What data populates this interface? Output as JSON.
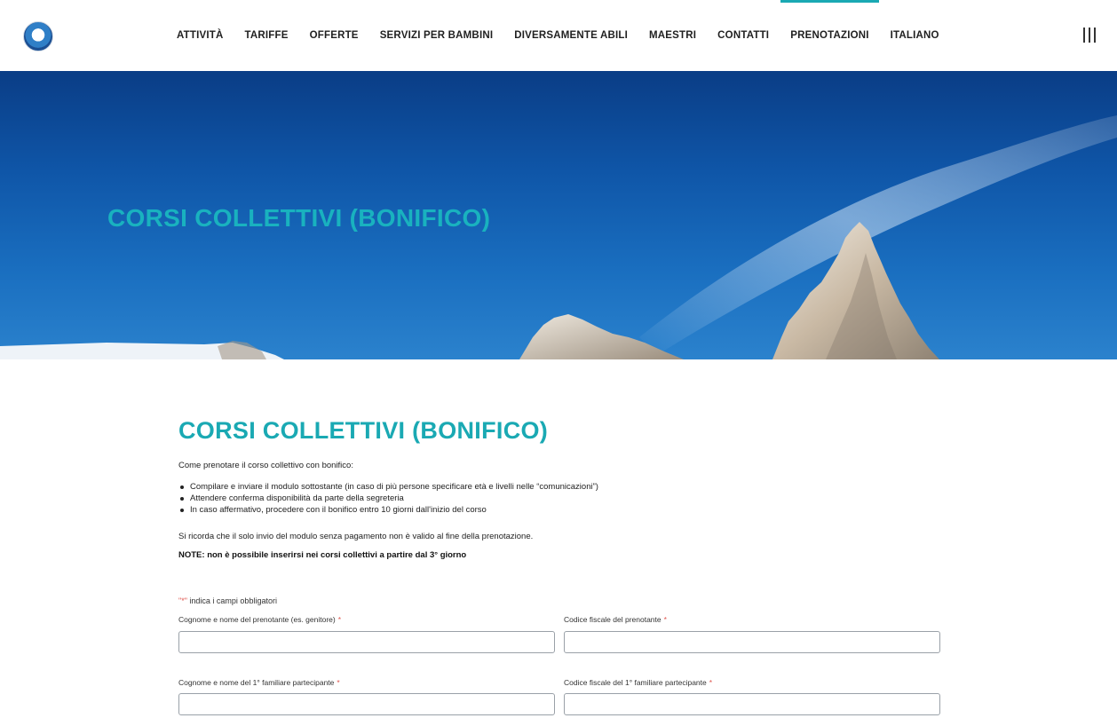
{
  "header": {
    "logo_name": "ski-school-logo",
    "nav": [
      {
        "label": "ATTIVITÀ"
      },
      {
        "label": "TARIFFE"
      },
      {
        "label": "OFFERTE"
      },
      {
        "label": "SERVIZI PER BAMBINI"
      },
      {
        "label": "DIVERSAMENTE ABILI"
      },
      {
        "label": "MAESTRI"
      },
      {
        "label": "CONTATTI"
      },
      {
        "label": "PRENOTAZIONI",
        "active": true
      },
      {
        "label": "ITALIANO"
      }
    ],
    "menu_icon": "hamburger-menu-icon"
  },
  "hero": {
    "title": "CORSI COLLETTIVI (BONIFICO)"
  },
  "main": {
    "title": "CORSI COLLETTIVI (BONIFICO)",
    "intro": "Come prenotare il corso collettivo con bonifico:",
    "steps": [
      "Compilare e inviare il modulo sottostante (in caso di più persone specificare età e livelli nelle “comunicazioni”)",
      "Attendere conferma disponibilità da parte della segreteria",
      "In caso affermativo, procedere con il bonifico entro 10 giorni dall'inizio del corso"
    ],
    "reminder": "Si ricorda che il solo invio del modulo senza pagamento non è valido al fine della prenotazione.",
    "note": "NOTE: non è possibile inserirsi nei corsi collettivi a partire dal 3° giorno"
  },
  "form": {
    "required_hint_mark": "\"*\"",
    "required_hint_text": " indica i campi obbligatori",
    "required_mark": "*",
    "fields": [
      {
        "label": "Cognome e nome del prenotante (es. genitore)",
        "value": ""
      },
      {
        "label": "Codice fiscale del prenotante",
        "value": ""
      },
      {
        "label": "Cognome e nome del 1° familiare partecipante",
        "value": ""
      },
      {
        "label": "Codice fiscale del 1° familiare partecipante",
        "value": ""
      }
    ]
  },
  "colors": {
    "accent": "#1aa9b3",
    "sky": "#0f56a8",
    "required": "#e0564f"
  }
}
